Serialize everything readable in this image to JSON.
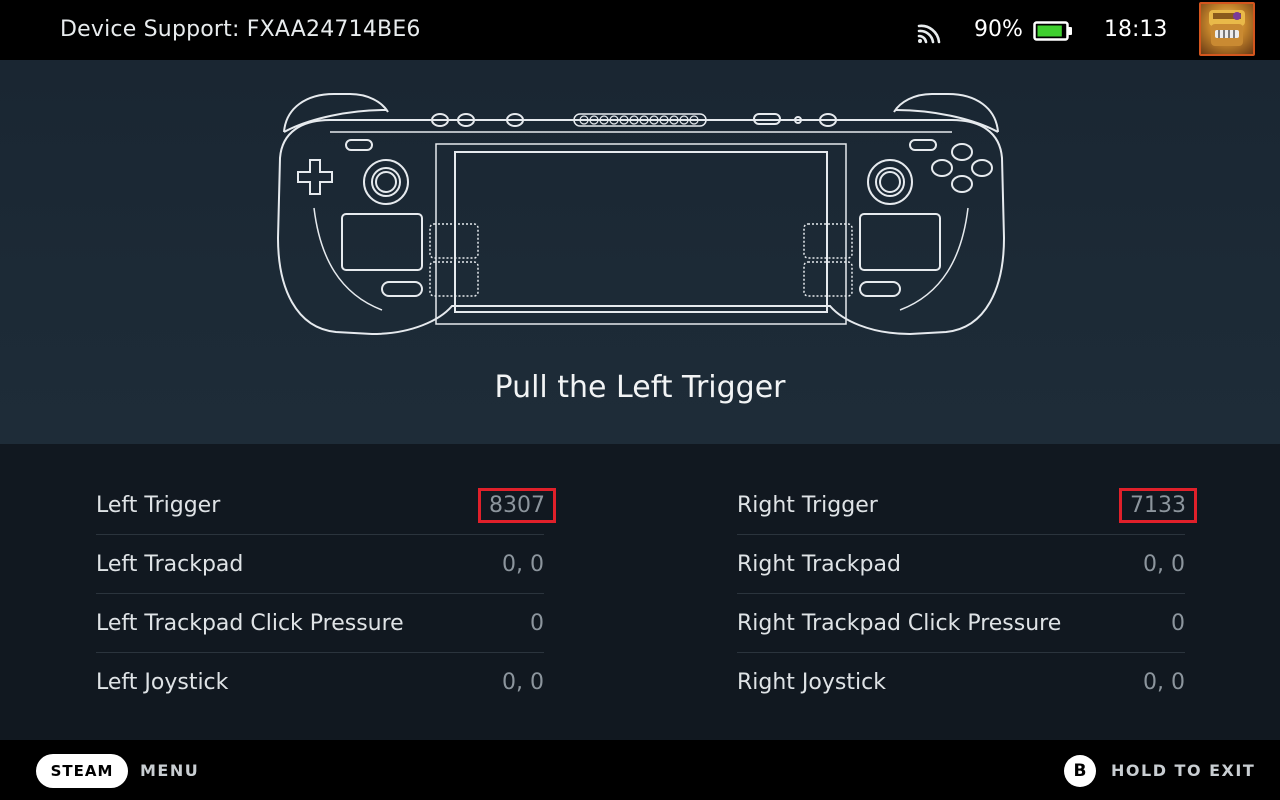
{
  "header": {
    "title": "Device Support: FXAA24714BE6",
    "battery_percent": "90%",
    "battery_level": 0.9,
    "clock": "18:13",
    "icons": {
      "wifi": "wifi-icon",
      "battery": "battery-icon",
      "avatar": "avatar"
    }
  },
  "prompt": "Pull the Left Trigger",
  "readouts": {
    "left": [
      {
        "label": "Left Trigger",
        "value": "8307",
        "highlighted": true
      },
      {
        "label": "Left Trackpad",
        "value": "0, 0",
        "highlighted": false
      },
      {
        "label": "Left Trackpad Click Pressure",
        "value": "0",
        "highlighted": false
      },
      {
        "label": "Left Joystick",
        "value": "0, 0",
        "highlighted": false
      }
    ],
    "right": [
      {
        "label": "Right Trigger",
        "value": "7133",
        "highlighted": true
      },
      {
        "label": "Right Trackpad",
        "value": "0, 0",
        "highlighted": false
      },
      {
        "label": "Right Trackpad Click Pressure",
        "value": "0",
        "highlighted": false
      },
      {
        "label": "Right Joystick",
        "value": "0, 0",
        "highlighted": false
      }
    ]
  },
  "footer": {
    "steam_label": "STEAM",
    "menu_label": "MENU",
    "b_label": "B",
    "exit_label": "HOLD TO EXIT"
  },
  "colors": {
    "highlight_box": "#e0202a",
    "battery_fill": "#3fcf2f",
    "background": "#111820"
  }
}
